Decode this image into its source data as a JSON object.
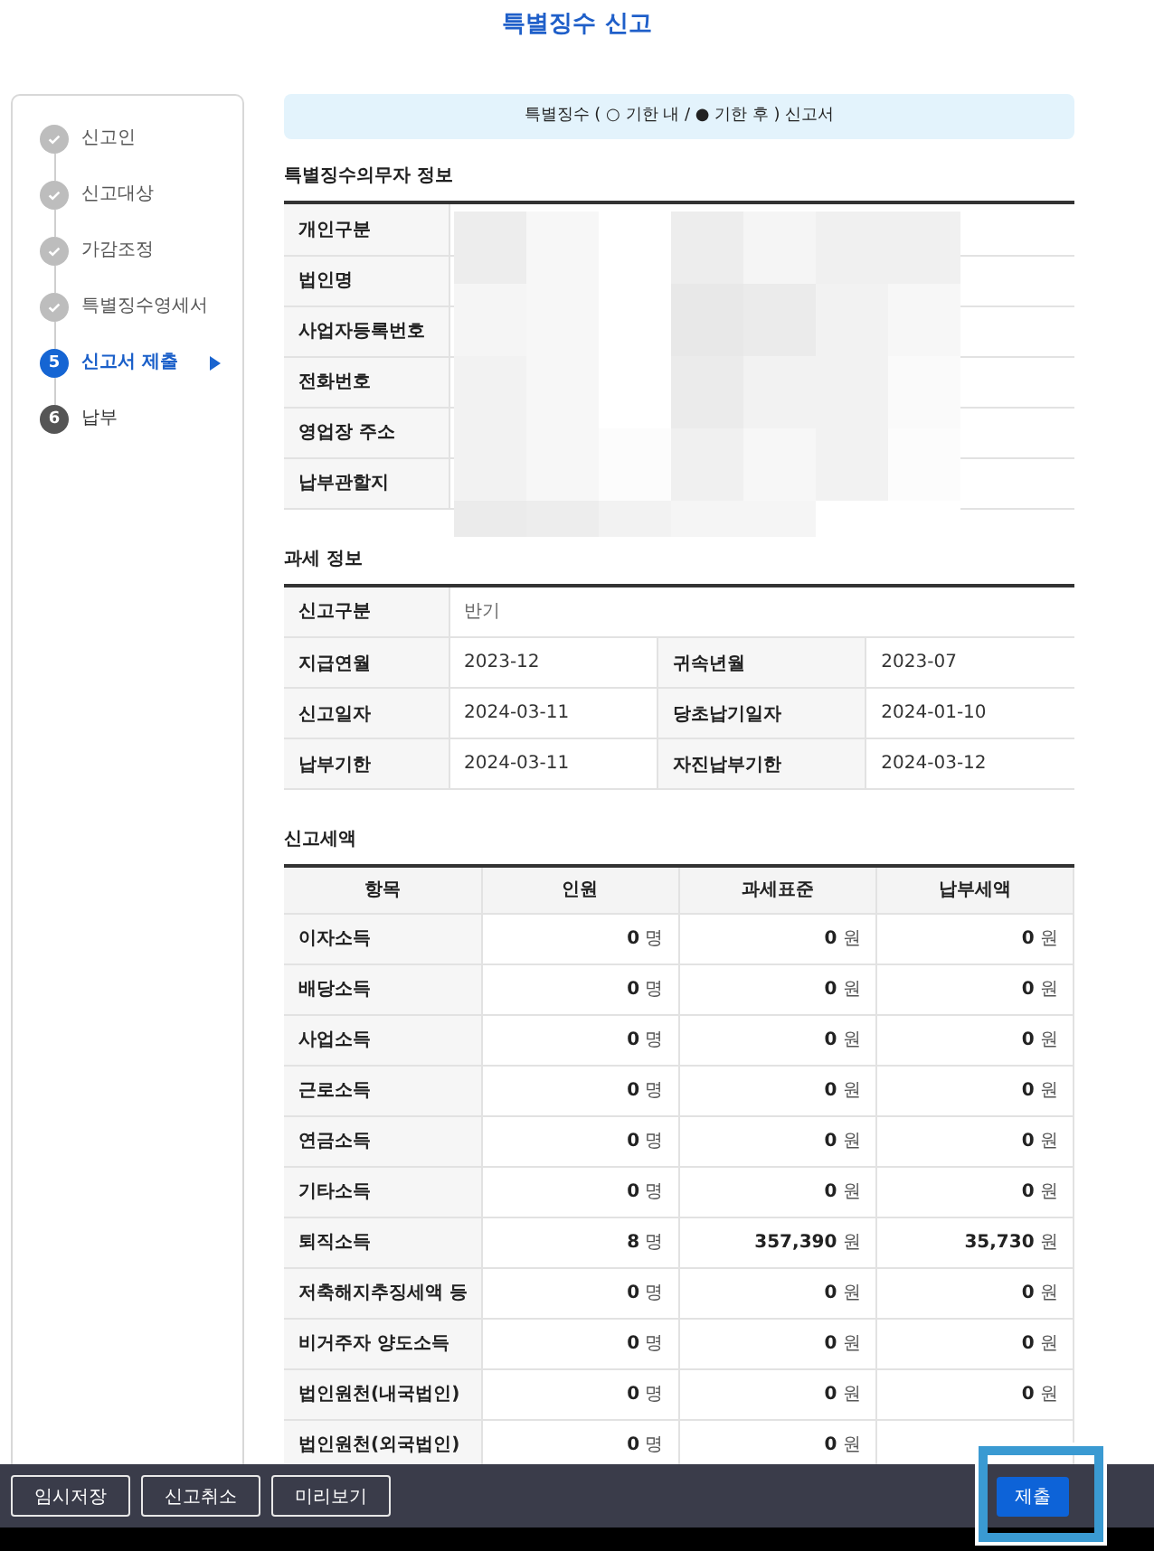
{
  "page_title": "특별징수 신고",
  "steps": [
    {
      "label": "신고인",
      "done": true,
      "selected": false
    },
    {
      "label": "신고대상",
      "done": true,
      "selected": false
    },
    {
      "label": "가감조정",
      "done": true,
      "selected": false
    },
    {
      "label": "특별징수영세서",
      "done": true,
      "selected": false
    },
    {
      "label": "신고서 제출",
      "number": "5",
      "done": false,
      "selected": true
    },
    {
      "label": "납부",
      "number": "6",
      "done": false,
      "selected": false
    }
  ],
  "notice": "특별징수 ( ○ 기한 내 / ● 기한 후 ) 신고서",
  "payer_info": {
    "title": "특별징수의무자 정보",
    "rows": [
      "개인구분",
      "법인명",
      "사업자등록번호",
      "전화번호",
      "영업장 주소",
      "납부관할지"
    ]
  },
  "tax_info": {
    "title": "과세 정보",
    "rows": [
      {
        "cells": [
          {
            "label": "신고구분",
            "value": "반기"
          }
        ]
      },
      {
        "cells": [
          {
            "label": "지급연월",
            "value": "2023-12"
          },
          {
            "label": "귀속년월",
            "value": "2023-07"
          }
        ]
      },
      {
        "cells": [
          {
            "label": "신고일자",
            "value": "2024-03-11"
          },
          {
            "label": "당초납기일자",
            "value": "2024-01-10"
          }
        ]
      },
      {
        "cells": [
          {
            "label": "납부기한",
            "value": "2024-03-11"
          },
          {
            "label": "자진납부기한",
            "value": "2024-03-12"
          }
        ]
      }
    ]
  },
  "report_amount": {
    "title": "신고세액",
    "columns": [
      "항목",
      "인원",
      "과세표준",
      "납부세액"
    ],
    "rows": [
      [
        "이자소득",
        "**0** 명",
        "**0** 원",
        "**0** 원"
      ],
      [
        "배당소득",
        "**0** 명",
        "**0** 원",
        "**0** 원"
      ],
      [
        "사업소득",
        "**0** 명",
        "**0** 원",
        "**0** 원"
      ],
      [
        "근로소득",
        "**0** 명",
        "**0** 원",
        "**0** 원"
      ],
      [
        "연금소득",
        "**0** 명",
        "**0** 원",
        "**0** 원"
      ],
      [
        "기타소득",
        "**0** 명",
        "**0** 원",
        "**0** 원"
      ],
      [
        "퇴직소득",
        "**8** 명",
        "**357,390** 원",
        "**35,730** 원"
      ],
      [
        "저축해지추징세액 등",
        "**0** 명",
        "**0** 원",
        "**0** 원"
      ],
      [
        "비거주자 양도소득",
        "**0** 명",
        "**0** 원",
        "**0** 원"
      ],
      [
        "법인원천(내국법인)",
        "**0** 명",
        "**0** 원",
        "**0** 원"
      ],
      [
        "법인원천(외국법인)",
        "**0** 명",
        "**0** 원",
        ""
      ]
    ]
  },
  "buttons": [
    {
      "label": "임시저장",
      "kind": "outline"
    },
    {
      "label": "신고취소",
      "kind": "outline"
    },
    {
      "label": "미리보기",
      "kind": "outline"
    },
    {
      "label": "제출",
      "kind": "primary"
    }
  ]
}
